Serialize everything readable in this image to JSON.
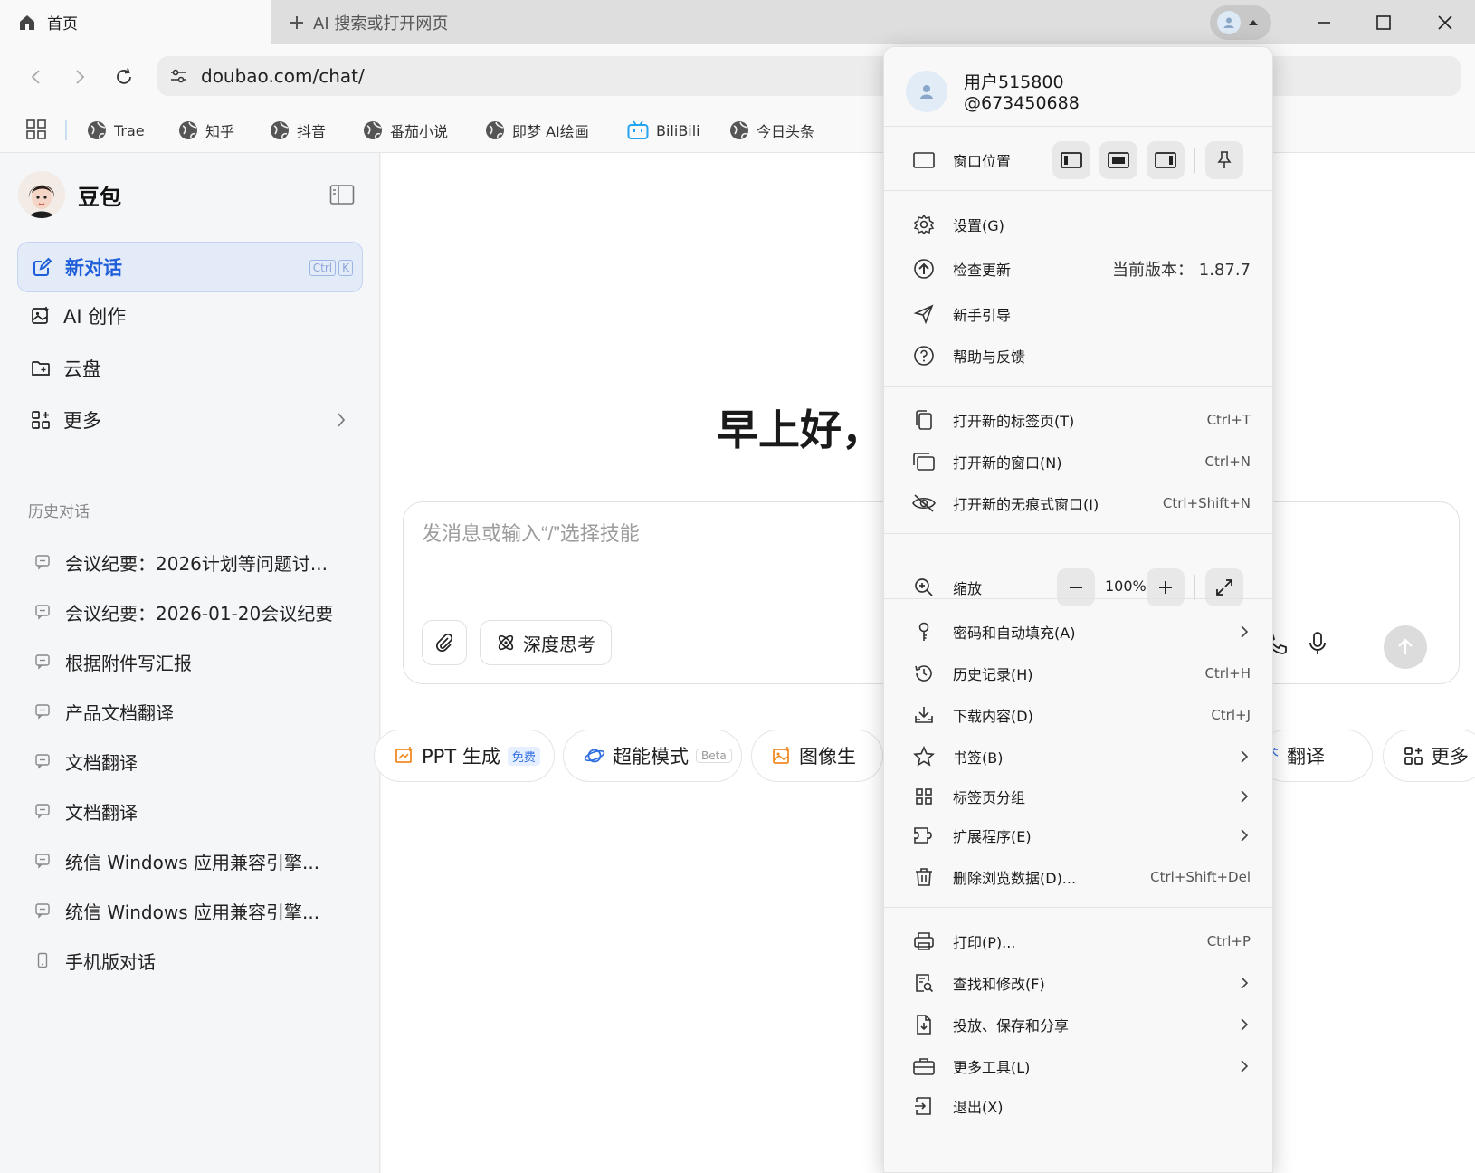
{
  "tabs": {
    "active_title": "首页",
    "new_tab_label": "AI 搜索或打开网页"
  },
  "address": {
    "url": "doubao.com/chat/"
  },
  "bookmarks": [
    {
      "label": "Trae"
    },
    {
      "label": "知乎"
    },
    {
      "label": "抖音"
    },
    {
      "label": "番茄小说"
    },
    {
      "label": "即梦 AI绘画"
    },
    {
      "label": "BiliBili"
    },
    {
      "label": "今日头条"
    }
  ],
  "sidebar": {
    "brand": "豆包",
    "new_chat": "新对话",
    "kbd_ctrl": "Ctrl",
    "kbd_k": "K",
    "items": [
      {
        "label": "AI 创作"
      },
      {
        "label": "云盘"
      },
      {
        "label": "更多"
      }
    ],
    "history_title": "历史对话",
    "history": [
      "会议纪要：2026计划等问题讨...",
      "会议纪要：2026-01-20会议纪要",
      "根据附件写汇报",
      "产品文档翻译",
      "文档翻译",
      "文档翻译",
      "统信 Windows 应用兼容引擎...",
      "统信 Windows 应用兼容引擎...",
      "手机版对话"
    ]
  },
  "main": {
    "greeting": "早上好，",
    "placeholder": "发消息或输入“/”选择技能",
    "deep_think": "深度思考",
    "chips": [
      {
        "label": "PPT 生成",
        "badge": "免费"
      },
      {
        "label": "超能模式",
        "badge": "Beta"
      },
      {
        "label": "图像生"
      },
      {
        "label": "翻译"
      },
      {
        "label": "更多"
      }
    ]
  },
  "menu": {
    "user_name": "用户515800",
    "user_id": "@673450688",
    "window_position": "窗口位置",
    "settings": "设置(G)",
    "check_update": "检查更新",
    "version": "当前版本：  1.87.7",
    "guide": "新手引导",
    "help": "帮助与反馈",
    "new_tab": "打开新的标签页(T)",
    "new_tab_sc": "Ctrl+T",
    "new_window": "打开新的窗口(N)",
    "new_window_sc": "Ctrl+N",
    "incognito": "打开新的无痕式窗口(I)",
    "incognito_sc": "Ctrl+Shift+N",
    "zoom": "缩放",
    "zoom_value": "100%",
    "passwords": "密码和自动填充(A)",
    "history": "历史记录(H)",
    "history_sc": "Ctrl+H",
    "downloads": "下载内容(D)",
    "downloads_sc": "Ctrl+J",
    "bookmarks": "书签(B)",
    "tab_groups": "标签页分组",
    "extensions": "扩展程序(E)",
    "clear_data": "删除浏览数据(D)...",
    "clear_data_sc": "Ctrl+Shift+Del",
    "print": "打印(P)...",
    "print_sc": "Ctrl+P",
    "find": "查找和修改(F)",
    "cast": "投放、保存和分享",
    "more_tools": "更多工具(L)",
    "exit": "退出(X)"
  },
  "colors": {
    "accent": "#1f5fd9",
    "new_chat_bg": "#e4ebf8",
    "chip_orange": "#f08a24",
    "bilibili": "#23a3f0"
  }
}
